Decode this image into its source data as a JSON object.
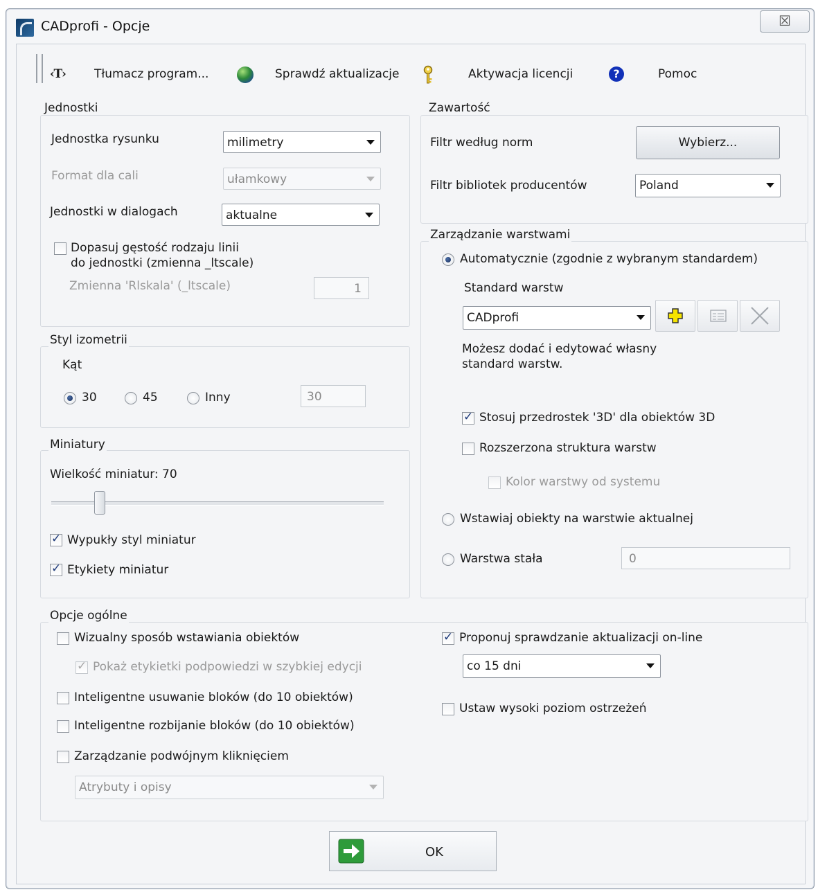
{
  "window": {
    "title": "CADprofi - Opcje",
    "close_glyph": "☒"
  },
  "toolbar": {
    "translate_icon_text": "‹T›",
    "translate_label": "Tłumacz program...",
    "updates_label": "Sprawdź aktualizacje",
    "license_label": "Aktywacja licencji",
    "help_label": "Pomoc",
    "icons": [
      "translate-icon",
      "globe-icon",
      "key-icon",
      "help-icon"
    ]
  },
  "units": {
    "group_label": "Jednostki",
    "drawing_unit_label": "Jednostka rysunku",
    "drawing_unit_value": "milimetry",
    "inch_format_label": "Format dla cali",
    "inch_format_value": "ułamkowy",
    "dialog_units_label": "Jednostki w dialogach",
    "dialog_units_value": "aktualne",
    "ltscale_checkbox_line1": "Dopasuj gęstość rodzaju linii",
    "ltscale_checkbox_line2": "do jednostki (zmienna _ltscale)",
    "ltscale_checked": false,
    "rlskala_label": "Zmienna 'Rlskala' (_ltscale)",
    "rlskala_value": "1"
  },
  "isometric": {
    "group_label": "Styl izometrii",
    "angle_label": "Kąt",
    "options": [
      "30",
      "45",
      "Inny"
    ],
    "selected": "30",
    "custom_value": "30"
  },
  "thumbnails": {
    "group_label": "Miniatury",
    "size_label": "Wielkość miniatur: 70",
    "size_value": 70,
    "convex_label": "Wypukły styl miniatur",
    "convex_checked": true,
    "labels_label": "Etykiety miniatur",
    "labels_checked": true
  },
  "content": {
    "group_label": "Zawartość",
    "norm_filter_label": "Filtr według norm",
    "select_button_label": "Wybierz...",
    "manufacturer_filter_label": "Filtr bibliotek producentów",
    "manufacturer_value": "Poland"
  },
  "layers": {
    "group_label": "Zarządzanie warstwami",
    "auto_label": "Automatycznie (zgodnie z wybranym standardem)",
    "auto_selected": true,
    "standard_label": "Standard warstw",
    "standard_value": "CADprofi",
    "hint_line1": "Możesz dodać i edytować własny",
    "hint_line2": "standard warstw.",
    "prefix3d_label": "Stosuj przedrostek '3D' dla obiektów 3D",
    "prefix3d_checked": true,
    "extended_label": "Rozszerzona struktura warstw",
    "extended_checked": false,
    "system_color_label": "Kolor warstwy od systemu",
    "system_color_checked": false,
    "current_layer_label": "Wstawiaj obiekty na warstwie aktualnej",
    "fixed_layer_label": "Warstwa stała",
    "fixed_layer_value": "0",
    "accent_color": "#f5e400"
  },
  "general": {
    "group_label": "Opcje ogólne",
    "visual_insert_label": "Wizualny sposób wstawiania obiektów",
    "visual_insert_checked": false,
    "hints_label": "Pokaż etykietki podpowiedzi w szybkiej edycji",
    "hints_checked": true,
    "smart_delete_label": "Inteligentne usuwanie bloków (do 10 obiektów)",
    "smart_delete_checked": false,
    "smart_explode_label": "Inteligentne rozbijanie bloków (do 10 obiektów)",
    "smart_explode_checked": false,
    "double_click_label": "Zarządzanie podwójnym kliknięciem",
    "double_click_checked": false,
    "double_click_value": "Atrybuty i opisy",
    "online_update_label": "Proponuj sprawdzanie aktualizacji on-line",
    "online_update_checked": true,
    "update_interval_value": "co 15 dni",
    "high_warning_label": "Ustaw wysoki poziom ostrzeżeń",
    "high_warning_checked": false
  },
  "footer": {
    "ok_label": "OK",
    "ok_icon_color": "#2e9b3a"
  }
}
